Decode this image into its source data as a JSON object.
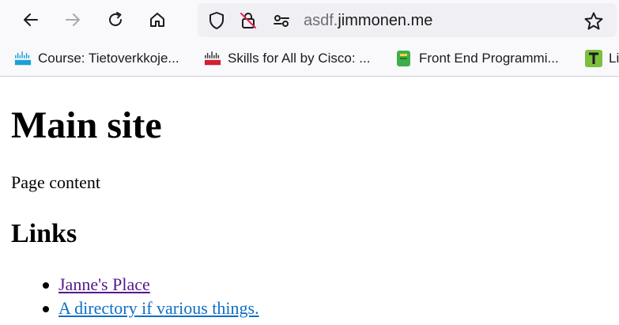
{
  "browser": {
    "url_prefix": "asdf.",
    "url_domain": "jimmonen.me",
    "bookmarks": [
      {
        "label": "Course: Tietoverkkoje...",
        "icon": "cisco-logo-icon"
      },
      {
        "label": "Skills for All by Cisco: ...",
        "icon": "cisco-logo-icon"
      },
      {
        "label": "Front End Programmi...",
        "icon": "green-book-icon"
      },
      {
        "label": "Li",
        "icon": "t-logo-icon"
      }
    ]
  },
  "page": {
    "title": "Main site",
    "body_text": "Page content",
    "links_heading": "Links",
    "links": [
      {
        "label": "Janne's Place",
        "visited": true
      },
      {
        "label": "A directory if various things.",
        "visited": false
      }
    ]
  },
  "colors": {
    "visited_link": "#551a8b",
    "link": "#0e6ec6"
  }
}
